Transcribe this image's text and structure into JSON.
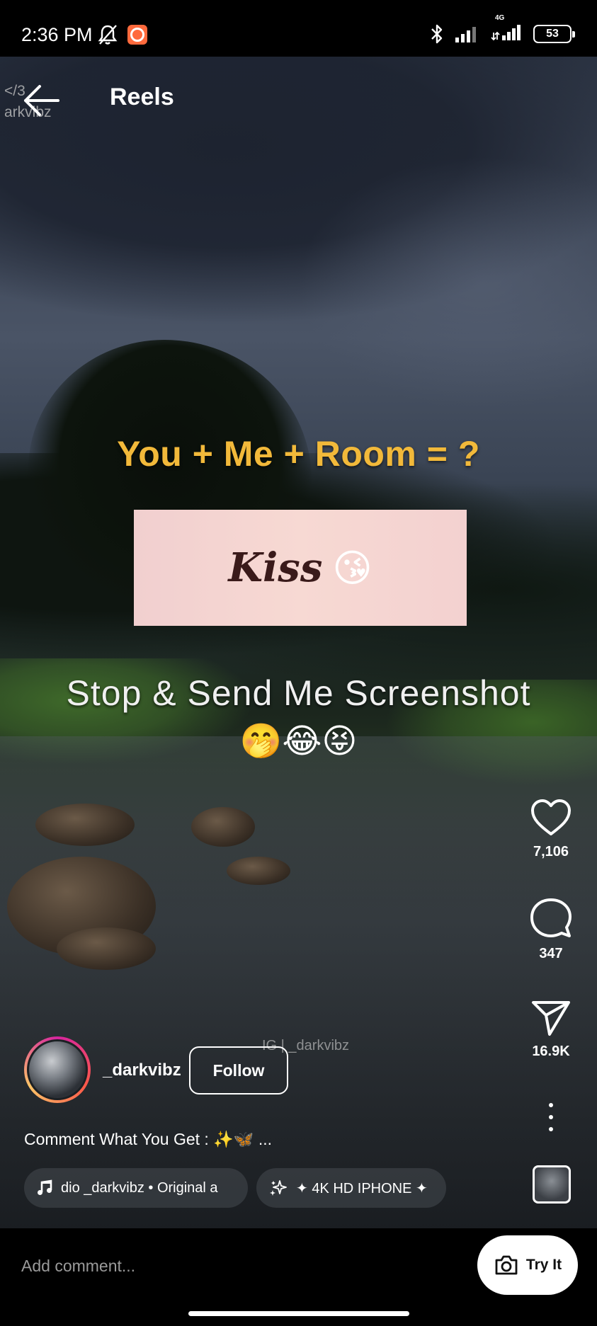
{
  "status_bar": {
    "time": "2:36 PM",
    "network_label": "4G",
    "battery": "53"
  },
  "header": {
    "title": "Reels",
    "watermark_line1": "</3",
    "watermark_line2": "arkvibz"
  },
  "video": {
    "question": "You + Me + Room = ?",
    "answer": "Kiss",
    "answer_emoji": "😘",
    "cta": "Stop & Send Me Screenshot",
    "cta_emojis": "🤭😂😝",
    "watermark": "IG | _darkvibz"
  },
  "actions": {
    "likes": "7,106",
    "comments": "347",
    "shares": "16.9K"
  },
  "author": {
    "username": "_darkvibz",
    "follow_label": "Follow"
  },
  "caption": "Comment What You Get : ✨🦋 ...",
  "chips": {
    "audio": "dio     _darkvibz • Original a",
    "effect": "✦ 4K HD IPHONE ✦"
  },
  "comment_bar": {
    "placeholder": "Add comment...",
    "try_label": "Try It"
  },
  "colors": {
    "question_text": "#f2b93a",
    "answer_box": "#f5d5d1",
    "story_ring_start": "#d6249f",
    "story_ring_end": "#fdc468"
  }
}
